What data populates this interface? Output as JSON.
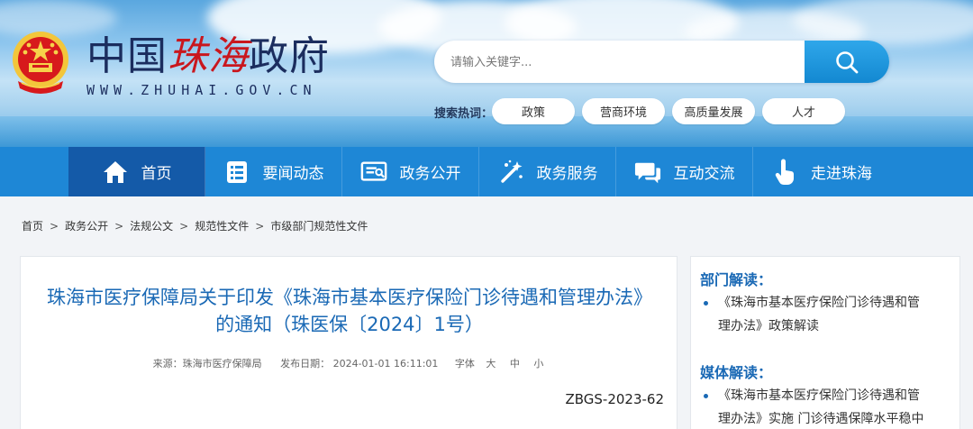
{
  "header": {
    "logo_cn_black1": "中国",
    "logo_cn_red": "珠海",
    "logo_cn_black2": "政府",
    "logo_en": "WWW.ZHUHAI.GOV.CN",
    "emblem_icon": "national-emblem-icon"
  },
  "search": {
    "placeholder": "请输入关键字...",
    "button_icon": "search-icon"
  },
  "hot_search": {
    "label": "搜索热词：",
    "tags": [
      "政策",
      "营商环境",
      "高质量发展",
      "人才"
    ]
  },
  "nav": {
    "items": [
      {
        "label": "首页",
        "icon": "home-icon"
      },
      {
        "label": "要闻动态",
        "icon": "news-list-icon"
      },
      {
        "label": "政务公开",
        "icon": "document-icon"
      },
      {
        "label": "政务服务",
        "icon": "service-wand-icon"
      },
      {
        "label": "互动交流",
        "icon": "chat-bubble-icon"
      },
      {
        "label": "走进珠海",
        "icon": "hand-pointer-icon"
      }
    ],
    "active_index": 0,
    "colors": {
      "bar": "#1e87d6",
      "active": "#145aa8"
    }
  },
  "breadcrumb": [
    "首页",
    "政务公开",
    "法规公文",
    "规范性文件",
    "市级部门规范性文件"
  ],
  "article": {
    "title_line1": "珠海市医疗保障局关于印发《珠海市基本医疗保险门诊待遇和管理办法》",
    "title_line2": "的通知（珠医保〔2024〕1号）",
    "source": "来源：珠海市医疗保障局",
    "date": "发布日期： 2024-01-01 16:11:01",
    "font_label": "字体",
    "font_large": "大",
    "font_medium": "中",
    "font_small": "小",
    "code": "ZBGS-2023-62"
  },
  "sidebar": {
    "dept_heading": "部门解读：",
    "dept_item_line1": "《珠海市基本医疗保险门诊待遇和管",
    "dept_item_line2": "理办法》政策解读",
    "media_heading": "媒体解读：",
    "media_item_line1": "《珠海市基本医疗保险门诊待遇和管",
    "media_item_line2": "理办法》实施 门诊待遇保障水平稳中"
  }
}
